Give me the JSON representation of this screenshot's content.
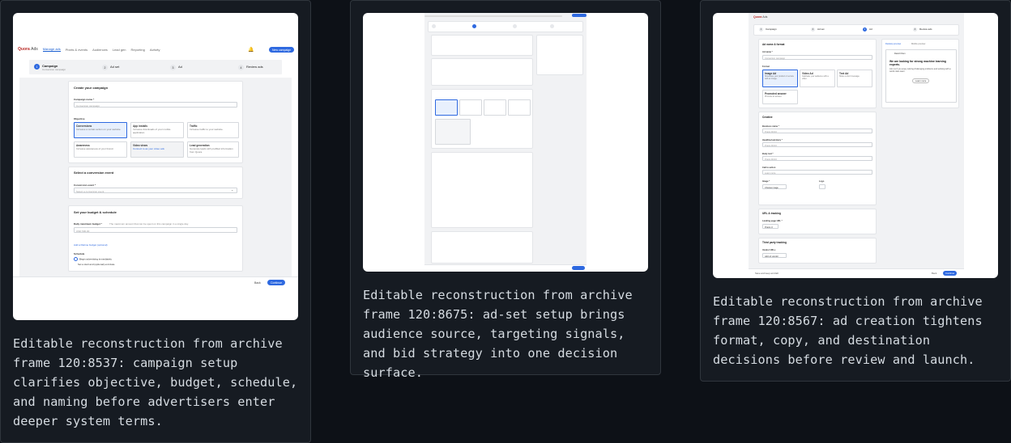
{
  "cards": [
    {
      "caption": "Editable reconstruction from archive frame 120:8537: campaign setup clarifies objective, budget, schedule, and naming before advertisers enter deeper system terms.",
      "frame": {
        "brand": "Quora",
        "brand_suffix": "Ads",
        "nav": [
          "Manage ads",
          "Pixels & events",
          "Audiences",
          "Lead gen",
          "Reporting",
          "Activity"
        ],
        "new_campaign": "New campaign",
        "steps": [
          {
            "num": "1",
            "title": "Campaign",
            "sub": "Conversion campaign"
          },
          {
            "num": "2",
            "title": "Ad set",
            "sub": ""
          },
          {
            "num": "3",
            "title": "Ad",
            "sub": ""
          },
          {
            "num": "4",
            "title": "Review ads",
            "sub": ""
          }
        ],
        "create_title": "Create your campaign",
        "campaign_name_label": "Campaign name *",
        "campaign_name_placeholder": "Conversion campaign",
        "objective_label": "Objective",
        "objectives": [
          {
            "title": "Conversions",
            "desc": "Increase a certain action on your website."
          },
          {
            "title": "App installs",
            "desc": "Increase downloads of your mobile application."
          },
          {
            "title": "Traffic",
            "desc": "Increase traffic to your website."
          },
          {
            "title": "Awareness",
            "desc": "Increase awareness of your brand."
          },
          {
            "title": "Video views",
            "desc": "Connect to as your video ads"
          },
          {
            "title": "Lead generation",
            "desc": "Generate leads with prefilled information from Quora."
          }
        ],
        "conversion_title": "Select a conversion event",
        "conversion_label": "Conversion event *",
        "conversion_placeholder": "Select a conversion event",
        "budget_title": "Set your budget & schedule",
        "daily_budget_label": "Daily maximum budget *",
        "daily_budget_help": "The maximum amount that can be spent on this campaign in a single day.",
        "daily_budget_placeholder": "USD 500.00",
        "lifetime_link": "Add a lifetime budget (optional)",
        "schedule_label": "Schedule",
        "schedule_opt1": "Begin advertising immediately",
        "schedule_opt2": "Set a start and (optional) end date",
        "back": "Back",
        "continue": "Continue"
      }
    },
    {
      "caption": "Editable reconstruction from archive frame 120:8675: ad-set setup brings audience source, targeting signals, and bid strategy into one decision surface."
    },
    {
      "caption": "Editable reconstruction from archive frame 120:8567: ad creation tightens format, copy, and destination decisions before review and launch.",
      "frame": {
        "brand": "Quora",
        "brand_suffix": "Ads",
        "steps": [
          {
            "num": "1",
            "title": "Campaign",
            "sub": ""
          },
          {
            "num": "2",
            "title": "Ad set",
            "sub": ""
          },
          {
            "num": "3",
            "title": "Ad",
            "sub": ""
          },
          {
            "num": "4",
            "title": "Review ads",
            "sub": ""
          }
        ],
        "section_title": "Ad name & format",
        "ad_name_label": "Ad name *",
        "ad_name_placeholder": "Conversion campaign",
        "format_label": "Format",
        "formats": [
          {
            "title": "Image Ad",
            "desc": "Showcase your product or service with an image."
          },
          {
            "title": "Video Ad",
            "desc": "Captivate your audience with a video."
          },
          {
            "title": "Text Ad",
            "desc": "Share a short message."
          },
          {
            "title": "Promoted answer",
            "desc": "Promote an answer."
          }
        ],
        "preview_tabs": [
          "Desktop preview",
          "Mobile preview"
        ],
        "preview_name": "David Chen",
        "preview_headline": "We are looking for strong machine learning experts.",
        "preview_body": "Join us if you enjoy solving challenging problems and working with a world class team.",
        "preview_cta": "Learn more",
        "creative_title": "Creative",
        "business_name_label": "Business name *",
        "business_name_placeholder": "Praxis World",
        "headline_label": "Headline/summary *",
        "headline_placeholder": "Praxis World",
        "body_label": "Body text *",
        "body_placeholder": "Praxis World",
        "cta_label": "Call to action",
        "cta_placeholder": "Learn more",
        "image_label": "Image *",
        "logo_label": "Logo",
        "choose_image": "Choose image",
        "url_title": "URL & tracking",
        "landing_label": "Landing page URL *",
        "landing_value": "Praxis U",
        "third_party_title": "Third party tracking",
        "vendor_label": "Vendor URLs",
        "add_vendor": "Add url vendor",
        "save_draft": "Save and keep ad draft",
        "back": "Back",
        "continue": "Continue"
      }
    }
  ]
}
